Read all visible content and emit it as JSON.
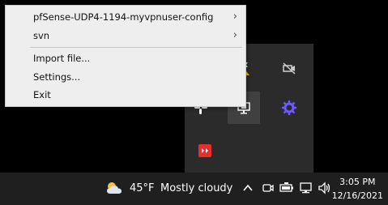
{
  "context_menu": {
    "items": [
      {
        "label": "pfSense-UDP4-1194-myvpnuser-config",
        "has_submenu": true
      },
      {
        "label": "svn",
        "has_submenu": true
      },
      {
        "label": "Import file...",
        "has_submenu": false
      },
      {
        "label": "Settings...",
        "has_submenu": false
      },
      {
        "label": "Exit",
        "has_submenu": false
      }
    ],
    "submenu_glyph": "›"
  },
  "tray_flyout": {
    "icons": [
      {
        "name": "flag-warning-icon"
      },
      {
        "name": "camera-off-icon"
      },
      {
        "name": "slack-icon"
      },
      {
        "name": "monitor-icon"
      },
      {
        "name": "gear-icon"
      },
      {
        "name": "app-red-icon"
      }
    ]
  },
  "taskbar": {
    "weather": {
      "temp": "45°F",
      "condition": "Mostly cloudy"
    },
    "clock": {
      "time": "3:05 PM",
      "date": "12/16/2021"
    }
  },
  "colors": {
    "menu_bg": "#eeeeee",
    "flyout_bg": "#2b2b2b",
    "taskbar_bg": "#1f1f1f",
    "accent_purple": "#6b5cff",
    "app_red": "#e3302f"
  }
}
